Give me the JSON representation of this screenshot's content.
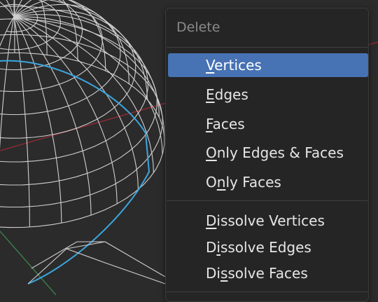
{
  "menu": {
    "title": "Delete",
    "items": [
      {
        "pre": "",
        "ul": "V",
        "post": "ertices",
        "active": true
      },
      {
        "pre": "",
        "ul": "E",
        "post": "dges",
        "active": false
      },
      {
        "pre": "",
        "ul": "F",
        "post": "aces",
        "active": false
      },
      {
        "pre": "",
        "ul": "O",
        "post": "nly Edges & Faces",
        "active": false
      },
      {
        "pre": "O",
        "ul": "n",
        "post": "ly Faces",
        "active": false
      },
      {
        "pre": "",
        "ul": "D",
        "post": "issolve Vertices",
        "active": false
      },
      {
        "pre": "D",
        "ul": "i",
        "post": "ssolve Edges",
        "active": false
      },
      {
        "pre": "Di",
        "ul": "s",
        "post": "solve Faces",
        "active": false
      }
    ]
  },
  "colors": {
    "viewport_bg": "#2b2b2b",
    "wire": "#d0d0d0",
    "selection_outline": "#3aa6e0",
    "x_axis": "#8a2a35",
    "y_axis": "#3a7a4a",
    "menu_bg": "#252525",
    "highlight": "#4772b3"
  }
}
